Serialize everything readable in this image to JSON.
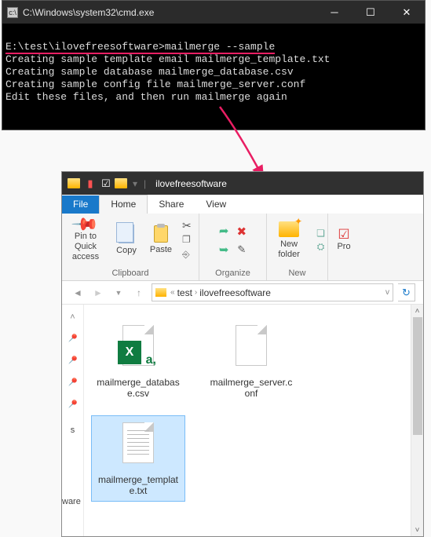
{
  "cmd": {
    "title": "C:\\Windows\\system32\\cmd.exe",
    "prompt_path": "E:\\test\\ilovefreesoftware>",
    "prompt_cmd": "mailmerge --sample",
    "line2": "Creating sample template email mailmerge_template.txt",
    "line3": "Creating sample database mailmerge_database.csv",
    "line4": "Creating sample config file mailmerge_server.conf",
    "line5": "Edit these files, and then run mailmerge again"
  },
  "explorer": {
    "window_title": "ilovefreesoftware",
    "tabs": {
      "file": "File",
      "home": "Home",
      "share": "Share",
      "view": "View"
    },
    "ribbon": {
      "pin": "Pin to Quick access",
      "copy": "Copy",
      "paste": "Paste",
      "clipboard_group": "Clipboard",
      "organize_group": "Organize",
      "newfolder": "New folder",
      "new_group": "New",
      "properties": "Pro"
    },
    "breadcrumb": {
      "c1": "test",
      "c2": "ilovefreesoftware"
    },
    "files": {
      "f1": "mailmerge_database.csv",
      "f2": "mailmerge_server.conf",
      "f3": "mailmerge_template.txt"
    },
    "leftnav_cut": "ware"
  },
  "colors": {
    "accent": "#1979ca",
    "annotate": "#e91e63"
  }
}
